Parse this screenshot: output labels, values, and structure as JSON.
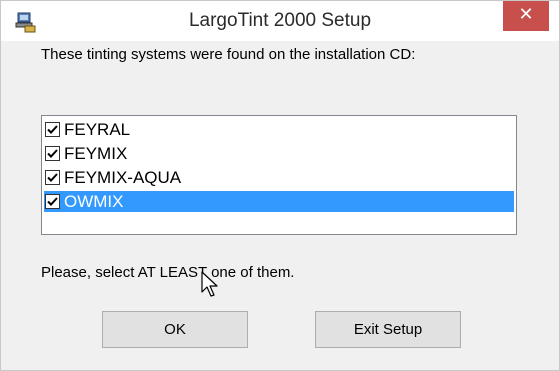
{
  "window": {
    "title": "LargoTint 2000 Setup",
    "close_symbol": "✕"
  },
  "content": {
    "intro_text": "These tinting systems were found on the installation CD:",
    "hint_text": "Please, select AT LEAST one of them."
  },
  "systems": [
    {
      "label": "FEYRAL",
      "checked": true,
      "selected": false
    },
    {
      "label": "FEYMIX",
      "checked": true,
      "selected": false
    },
    {
      "label": "FEYMIX-AQUA",
      "checked": true,
      "selected": false
    },
    {
      "label": "OWMIX",
      "checked": true,
      "selected": true
    }
  ],
  "buttons": {
    "ok_label": "OK",
    "exit_label": "Exit Setup"
  },
  "colors": {
    "selection": "#3399ff",
    "close_button": "#c7504d"
  }
}
